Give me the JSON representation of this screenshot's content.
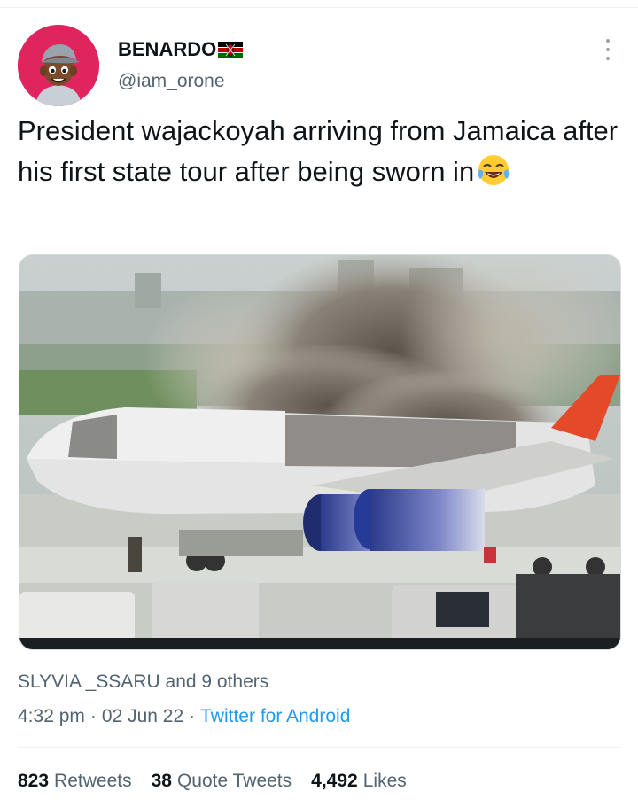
{
  "author": {
    "display_name": "BENARDO",
    "handle": "@iam_orone",
    "flag_icon": "kenya-flag-icon",
    "avatar_bg": "#e0245e"
  },
  "tweet": {
    "text": "President wajackoyah arriving from Jamaica after his first state tour after being sworn in",
    "emoji": "face-with-tears-of-joy"
  },
  "meta": {
    "liked_by": "SLYVIA _SSARU and 9 others",
    "time": "4:32 pm",
    "dot": "·",
    "date": "02 Jun 22",
    "source": "Twitter for Android"
  },
  "stats": {
    "retweets_count": "823",
    "retweets_label": "Retweets",
    "quotes_count": "38",
    "quotes_label": "Quote Tweets",
    "likes_count": "4,492",
    "likes_label": "Likes"
  },
  "colors": {
    "link": "#1d9bf0",
    "secondary_text": "#536471",
    "primary_text": "#0f1419"
  }
}
